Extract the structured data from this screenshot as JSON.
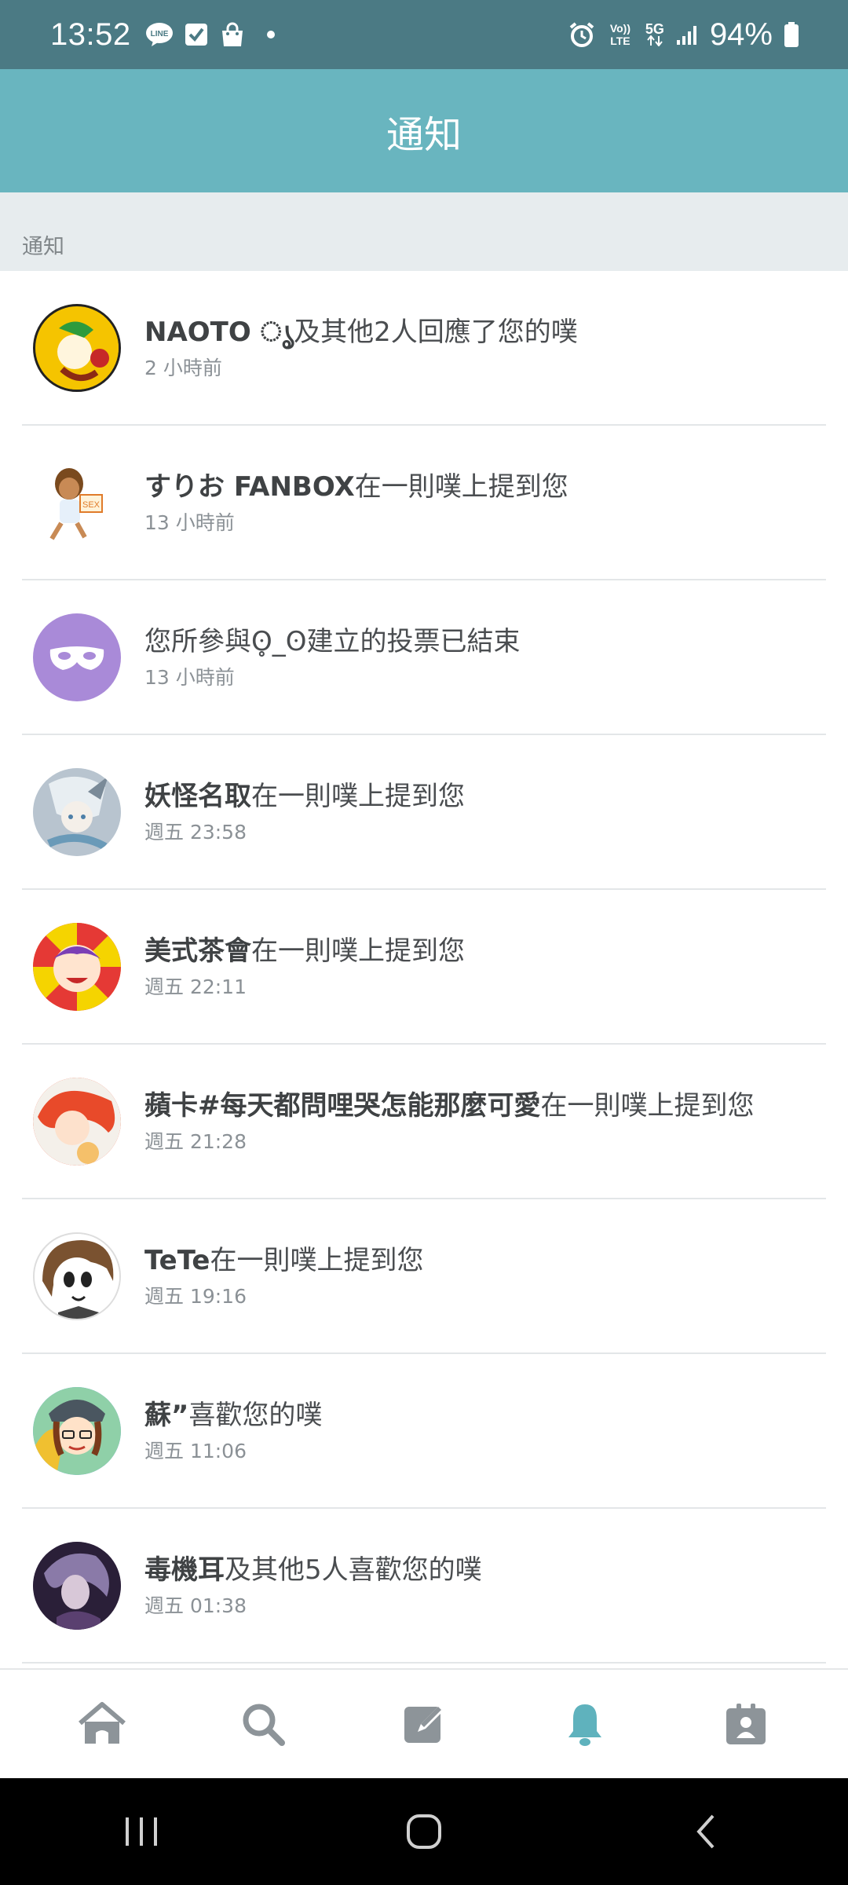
{
  "status_bar": {
    "time": "13:52",
    "battery": "94%",
    "network": "5G",
    "volte": "Vo)) LTE",
    "icons_left": [
      "line-icon",
      "check-icon",
      "bag-icon",
      "dot-icon"
    ],
    "icons_right": [
      "alarm-icon",
      "volte-icon",
      "5g-icon",
      "signal-icon",
      "battery-icon"
    ]
  },
  "header": {
    "title": "通知"
  },
  "section": {
    "label": "通知"
  },
  "notifications": [
    {
      "name": "NAOTO ൃ",
      "action": "及其他2人回應了您的噗",
      "time": "2 小時前",
      "avatar_color": "#f5c400"
    },
    {
      "name": "すりお FANBOX",
      "action": "在一則噗上提到您",
      "time": "13 小時前",
      "avatar_color": "#ffffff"
    },
    {
      "name": "",
      "action": "您所參與ʘ̥_ʘ建立的投票已結束",
      "time": "13 小時前",
      "avatar_color": "#a98ad8"
    },
    {
      "name": "妖怪名取",
      "action": "在一則噗上提到您",
      "time": "週五 23:58",
      "avatar_color": "#c9d3dc"
    },
    {
      "name": "美式茶會",
      "action": "在一則噗上提到您",
      "time": "週五 22:11",
      "avatar_color": "#e53935"
    },
    {
      "name": "蘋卡#每天都問哩哭怎能那麼可愛",
      "action": "在一則噗上提到您",
      "time": "週五 21:28",
      "avatar_color": "#f06040"
    },
    {
      "name": "TeTe",
      "action": "在一則噗上提到您",
      "time": "週五 19:16",
      "avatar_color": "#ffffff"
    },
    {
      "name": "蘇”",
      "action": "喜歡您的噗",
      "time": "週五 11:06",
      "avatar_color": "#62a8d8"
    },
    {
      "name": "毒機耳",
      "action": "及其他5人喜歡您的噗",
      "time": "週五 01:38",
      "avatar_color": "#3c2a4e"
    }
  ],
  "bottom_nav": [
    {
      "icon": "home-icon",
      "active": false
    },
    {
      "icon": "search-icon",
      "active": false
    },
    {
      "icon": "compose-icon",
      "active": false
    },
    {
      "icon": "bell-icon",
      "active": true
    },
    {
      "icon": "profile-icon",
      "active": false
    }
  ],
  "colors": {
    "status_bar": "#4b7a84",
    "header": "#69b5bf",
    "section_bg": "#e7ecee",
    "nav_inactive": "#8d9499",
    "nav_active": "#5fb2bd"
  }
}
